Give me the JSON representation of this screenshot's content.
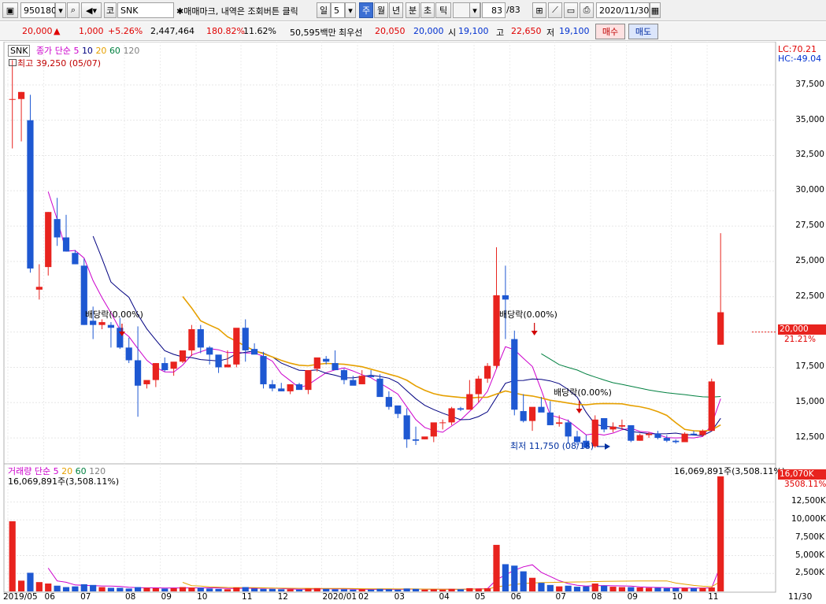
{
  "toolbar": {
    "code_value": "950180",
    "market_label": "코",
    "name_value": "SNK",
    "hint_text": "✱매매마크, 내역은 조회버튼 클릭",
    "period_day": "일",
    "period_count": "5",
    "period_week": "주",
    "period_month": "월",
    "period_year": "년",
    "period_minute": "분",
    "period_second": "초",
    "period_tick": "틱",
    "page_counter": "83",
    "page_total": "/83",
    "date_value": "2020/11/30"
  },
  "quote": {
    "price": "20,000",
    "change": "1,000",
    "change_pct": "+5.26%",
    "volume": "2,447,464",
    "vol_ratio": "180.82%",
    "turnover": "11.62%",
    "amount": "50,595백만",
    "best_label": "최우선",
    "best_ask": "20,050",
    "best_bid": "20,000",
    "open_label": "시",
    "open": "19,100",
    "high_label": "고",
    "high": "22,650",
    "low_label": "저",
    "low": "19,100",
    "buy_label": "매수",
    "sell_label": "매도"
  },
  "colors": {
    "up": "#e8231e",
    "down": "#1e58d2",
    "ma5": "#cc00cc",
    "ma10": "#000080",
    "ma20": "#e6a000",
    "ma60": "#008040",
    "ma120": "#606060"
  },
  "chart_data": [
    {
      "type": "candlestick",
      "legend": {
        "name": "SNK",
        "price_label": "종가",
        "ma_label": "단순",
        "ma": [
          "5",
          "10",
          "20",
          "60",
          "120"
        ]
      },
      "lc_label": "LC:70.21",
      "hc_label": "HC:-49.04",
      "max_label": "최고 39,250 (05/07)",
      "min_label": "최저 11,750 (08/18)",
      "dividend_labels": [
        "배당락(0.00%)",
        "배당락(0.00%)",
        "배당락(0.00%)"
      ],
      "current_price_tag": "20,000",
      "current_pct_tag": "21.21%",
      "y_ticks": [
        "37,500",
        "35,000",
        "32,500",
        "30,000",
        "27,500",
        "25,000",
        "22,500",
        "20,000",
        "17,500",
        "15,000",
        "12,500"
      ],
      "ylim": [
        11000,
        40000
      ],
      "x_ticks": [
        "2019/05",
        "06",
        "07",
        "08",
        "09",
        "10",
        "11",
        "12",
        "2020/01",
        "02",
        "03",
        "04",
        "05",
        "06",
        "07",
        "08",
        "09",
        "10",
        "11",
        "11/30"
      ],
      "weeks": [
        [
          36500,
          39250,
          33000,
          36500
        ],
        [
          36500,
          37000,
          33500,
          37000
        ],
        [
          35000,
          36800,
          24200,
          24500
        ],
        [
          23000,
          24800,
          22300,
          23200
        ],
        [
          24600,
          28500,
          24000,
          28500
        ],
        [
          28000,
          29500,
          26100,
          26700
        ],
        [
          26700,
          28300,
          26000,
          25700
        ],
        [
          25600,
          25800,
          24800,
          24800
        ],
        [
          24700,
          25200,
          20500,
          20500
        ],
        [
          20800,
          21800,
          19500,
          20500
        ],
        [
          20500,
          20900,
          20200,
          20700
        ],
        [
          20500,
          20700,
          18900,
          20300
        ],
        [
          20300,
          21000,
          18800,
          18900
        ],
        [
          18900,
          19600,
          17800,
          18000
        ],
        [
          18000,
          20400,
          14000,
          16200
        ],
        [
          16300,
          16400,
          16000,
          16600
        ],
        [
          16600,
          17800,
          16100,
          17800
        ],
        [
          17800,
          18200,
          17200,
          17300
        ],
        [
          17400,
          17700,
          16900,
          17900
        ],
        [
          17900,
          18100,
          17800,
          18700
        ],
        [
          18700,
          20500,
          18300,
          20200
        ],
        [
          20200,
          20500,
          18500,
          18900
        ],
        [
          18900,
          19000,
          17700,
          18400
        ],
        [
          18400,
          17900,
          17100,
          17500
        ],
        [
          17500,
          18700,
          17500,
          17700
        ],
        [
          17700,
          19900,
          17500,
          20300
        ],
        [
          20300,
          20900,
          17900,
          18700
        ],
        [
          18800,
          19200,
          18500,
          18400
        ],
        [
          18300,
          18600,
          16000,
          16300
        ],
        [
          16300,
          16600,
          15800,
          16000
        ],
        [
          16000,
          16400,
          15800,
          15800
        ],
        [
          15800,
          16300,
          15600,
          16300
        ],
        [
          16300,
          16400,
          16000,
          15900
        ],
        [
          15900,
          16900,
          15600,
          17300
        ],
        [
          17400,
          18100,
          17200,
          18200
        ],
        [
          18100,
          18300,
          17700,
          17900
        ],
        [
          17800,
          18700,
          17600,
          17300
        ],
        [
          17300,
          17400,
          16300,
          16600
        ],
        [
          16600,
          16900,
          16500,
          16200
        ],
        [
          16300,
          17300,
          16300,
          16900
        ],
        [
          16900,
          17300,
          16900,
          16800
        ],
        [
          16700,
          17000,
          15700,
          15400
        ],
        [
          15400,
          15800,
          14500,
          14700
        ],
        [
          14800,
          14700,
          13900,
          14200
        ],
        [
          14100,
          14600,
          11800,
          12400
        ],
        [
          12400,
          13300,
          12000,
          12300
        ],
        [
          12400,
          12500,
          12400,
          12600
        ],
        [
          12600,
          12700,
          12200,
          13600
        ],
        [
          13600,
          13800,
          13100,
          13600
        ],
        [
          13600,
          14700,
          13400,
          14600
        ],
        [
          14600,
          14700,
          14400,
          14500
        ],
        [
          14500,
          16600,
          14600,
          15600
        ],
        [
          15600,
          16900,
          15000,
          16700
        ],
        [
          16700,
          17800,
          16400,
          17600
        ],
        [
          17600,
          26000,
          17400,
          22600
        ],
        [
          22600,
          24700,
          19500,
          22300
        ],
        [
          19500,
          20100,
          14100,
          14500
        ],
        [
          14400,
          15600,
          13600,
          13700
        ],
        [
          13700,
          14300,
          13000,
          14700
        ],
        [
          14700,
          15400,
          14400,
          14300
        ],
        [
          14300,
          15100,
          13400,
          13400
        ],
        [
          13500,
          14100,
          13300,
          13600
        ],
        [
          13600,
          13800,
          12100,
          12600
        ],
        [
          12600,
          13000,
          12000,
          12200
        ],
        [
          12300,
          12700,
          11750,
          11800
        ],
        [
          11900,
          14100,
          11800,
          13800
        ],
        [
          13900,
          13900,
          12900,
          13100
        ],
        [
          13100,
          13600,
          12900,
          13300
        ],
        [
          13300,
          13800,
          13100,
          13400
        ],
        [
          13400,
          13400,
          12200,
          12300
        ],
        [
          12300,
          12800,
          12300,
          12700
        ],
        [
          12700,
          12900,
          12500,
          12800
        ],
        [
          12800,
          13000,
          12400,
          12500
        ],
        [
          12500,
          12700,
          12200,
          12300
        ],
        [
          12300,
          12400,
          12100,
          12200
        ],
        [
          12200,
          12900,
          12300,
          12800
        ],
        [
          12800,
          13000,
          12700,
          12700
        ],
        [
          12700,
          13100,
          12600,
          13000
        ],
        [
          13000,
          16700,
          13000,
          16500
        ],
        [
          19100,
          27000,
          19100,
          21400
        ],
        [
          20000,
          20000,
          20000,
          20000
        ],
        [
          20000,
          20000,
          20000,
          20000
        ],
        [
          20000,
          20000,
          20000,
          20000
        ]
      ]
    },
    {
      "type": "bar",
      "legend": {
        "name": "거래량",
        "ma_label": "단순",
        "ma": [
          "5",
          "20",
          "60",
          "120"
        ]
      },
      "left_value_label": "16,069,891주(3,508.11%)",
      "right_value_label": "16,069,891주(3,508.11%)",
      "current_tag": "16,070K",
      "current_pct": "3508.11%",
      "y_ticks": [
        "12,500K",
        "10,000K",
        "7,500K",
        "5,000K",
        "2,500K"
      ],
      "ylim": [
        0,
        16500
      ]
    }
  ]
}
